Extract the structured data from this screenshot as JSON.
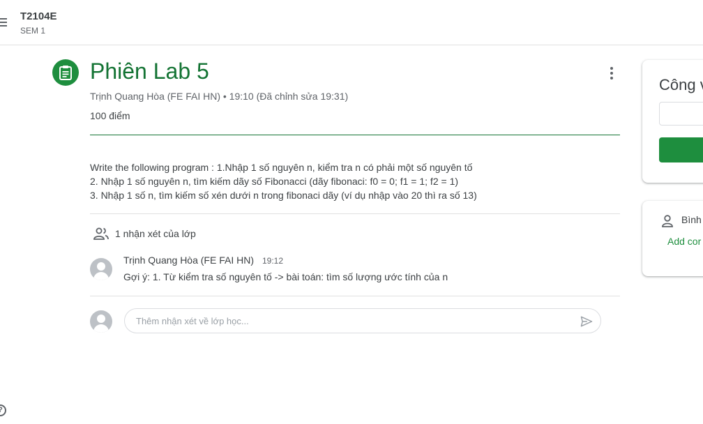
{
  "header": {
    "class_name": "T2104E",
    "section": "SEM 1"
  },
  "assignment": {
    "title": "Phiên Lab 5",
    "meta": "Trịnh Quang Hòa (FE FAI HN) • 19:10  (Đã chỉnh sửa 19:31)",
    "points": "100 điểm",
    "description": [
      "Write the following program : 1.Nhập 1 số nguyên n, kiểm tra n có phải một số nguyên tố",
      "2. Nhập 1 số nguyên n, tìm kiếm dãy số Fibonacci (dãy fibonaci: f0 = 0; f1 = 1; f2 = 1)",
      "3. Nhập 1 số n, tìm kiếm số xén dưới n trong fibonaci dãy (ví dụ nhập vào 20 thì ra số 13)"
    ]
  },
  "comments": {
    "header": "1 nhận xét của lớp",
    "items": [
      {
        "author": "Trịnh Quang Hòa (FE FAI HN)",
        "time": "19:12",
        "text": "Gợi ý: 1. Từ kiểm tra số nguyên tố -> bài toán: tìm số lượng ước tính của n"
      }
    ],
    "input_placeholder": "Thêm nhận xét về lớp học..."
  },
  "side": {
    "work_card_title": "Công v",
    "private_label": "Bình",
    "private_add": "Add cor"
  },
  "colors": {
    "brand_green": "#1e8e3e",
    "title_green": "#137333",
    "text": "#3c4043",
    "muted": "#5f6368"
  },
  "icons": [
    "menu-icon",
    "assignment-icon",
    "more-vert-icon",
    "people-icon",
    "avatar-icon",
    "send-icon",
    "help-icon",
    "person-icon"
  ]
}
